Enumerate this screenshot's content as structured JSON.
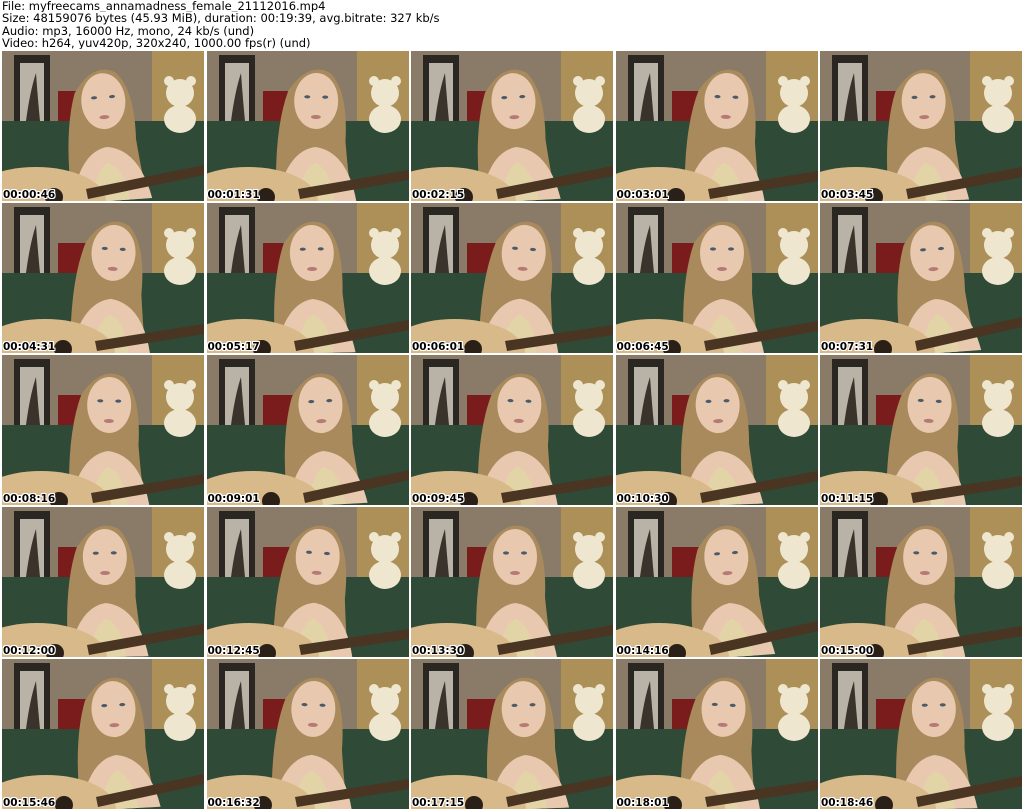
{
  "header": {
    "file_line": "File: myfreecams_annamadness_female_21112016.mp4",
    "size_line": "Size: 48159076 bytes (45.93 MiB), duration: 00:19:39, avg.bitrate: 327 kb/s",
    "audio_line": "Audio: mp3, 16000 Hz, mono, 24 kb/s (und)",
    "video_line": "Video: h264, yuv420p, 320x240, 1000.00 fps(r) (und)"
  },
  "palette": {
    "wall": "#8a7a68",
    "frame_dark": "#2a2622",
    "frame_picture": "#b9b2a6",
    "curtain_red": "#7a1c1c",
    "sofa_green": "#2f4a36",
    "bear": "#efe6cf",
    "hair": "#a88a5c",
    "skin": "#e8c8ae",
    "guitar": "#d8b98a",
    "guitar_neck": "#4a3422"
  },
  "thumbnails": [
    {
      "timestamp": "00:00:46"
    },
    {
      "timestamp": "00:01:31"
    },
    {
      "timestamp": "00:02:15"
    },
    {
      "timestamp": "00:03:01"
    },
    {
      "timestamp": "00:03:45"
    },
    {
      "timestamp": "00:04:31"
    },
    {
      "timestamp": "00:05:17"
    },
    {
      "timestamp": "00:06:01"
    },
    {
      "timestamp": "00:06:45"
    },
    {
      "timestamp": "00:07:31"
    },
    {
      "timestamp": "00:08:16"
    },
    {
      "timestamp": "00:09:01"
    },
    {
      "timestamp": "00:09:45"
    },
    {
      "timestamp": "00:10:30"
    },
    {
      "timestamp": "00:11:15"
    },
    {
      "timestamp": "00:12:00"
    },
    {
      "timestamp": "00:12:45"
    },
    {
      "timestamp": "00:13:30"
    },
    {
      "timestamp": "00:14:16"
    },
    {
      "timestamp": "00:15:00"
    },
    {
      "timestamp": "00:15:46"
    },
    {
      "timestamp": "00:16:32"
    },
    {
      "timestamp": "00:17:15"
    },
    {
      "timestamp": "00:18:01"
    },
    {
      "timestamp": "00:18:46"
    }
  ]
}
